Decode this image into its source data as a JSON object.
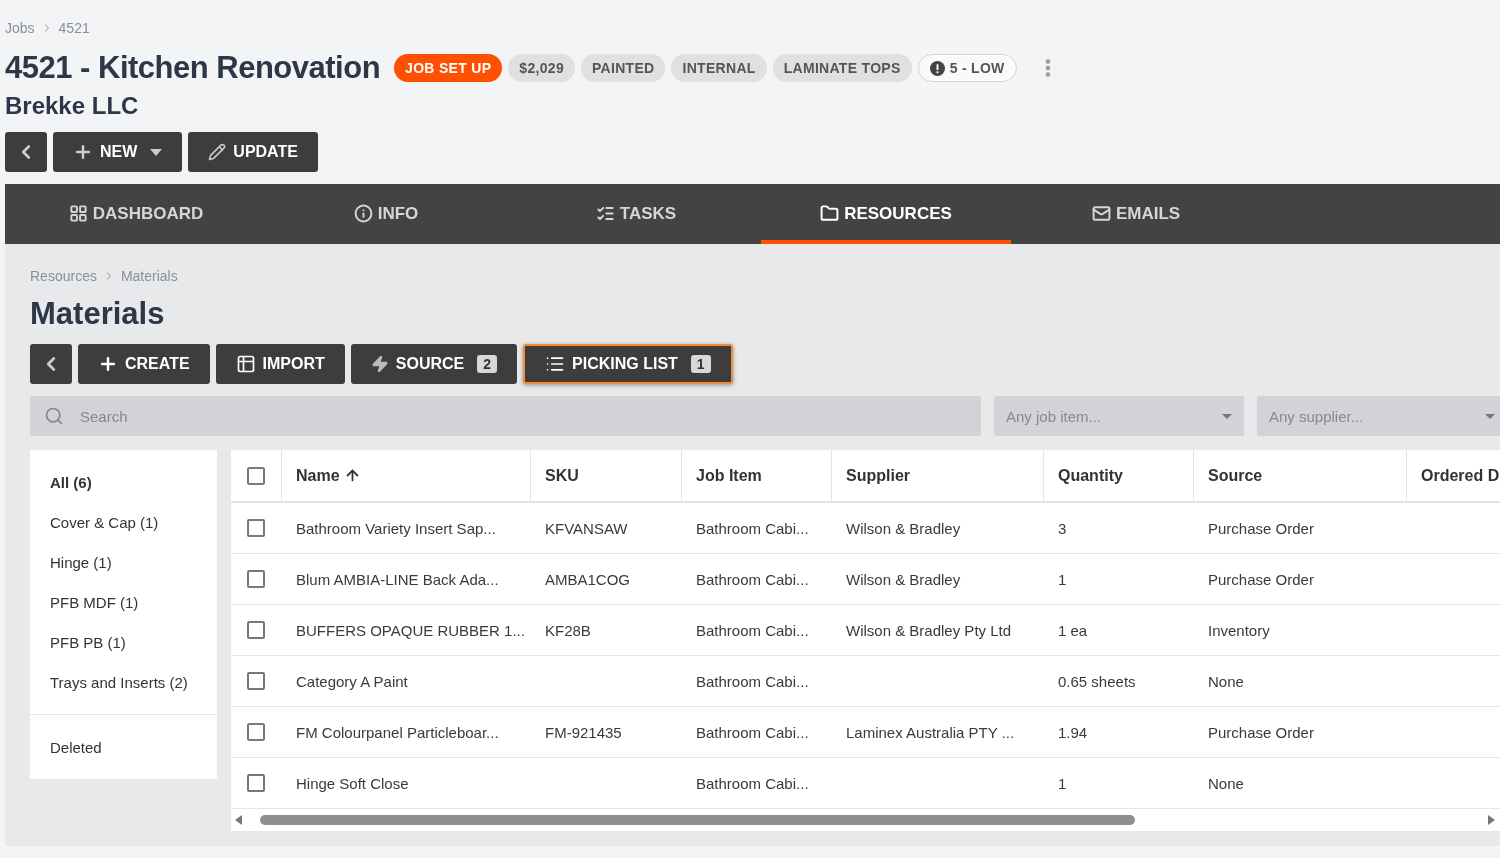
{
  "breadcrumb": [
    "Jobs",
    "4521"
  ],
  "title": "4521 - Kitchen Renovation",
  "tags": [
    {
      "kind": "status",
      "label": "JOB SET UP"
    },
    {
      "kind": "tag",
      "label": "$2,029"
    },
    {
      "kind": "tag",
      "label": "PAINTED"
    },
    {
      "kind": "tag",
      "label": "INTERNAL"
    },
    {
      "kind": "tag",
      "label": "LAMINATE TOPS"
    },
    {
      "kind": "priority",
      "label": "5 - LOW"
    }
  ],
  "customer": "Brekke LLC",
  "actions": [
    {
      "kind": "back"
    },
    {
      "kind": "new",
      "label": "NEW"
    },
    {
      "kind": "update",
      "label": "UPDATE"
    }
  ],
  "tabs": [
    {
      "label": "DASHBOARD",
      "selected": false
    },
    {
      "label": "INFO",
      "selected": false
    },
    {
      "label": "TASKS",
      "selected": false
    },
    {
      "label": "RESOURCES",
      "selected": true
    },
    {
      "label": "EMAILS",
      "selected": false
    }
  ],
  "section_breadcrumb": [
    "Resources",
    "Materials"
  ],
  "section_title": "Materials",
  "toolbar": [
    {
      "kind": "back"
    },
    {
      "kind": "create",
      "label": "CREATE",
      "selected": false
    },
    {
      "kind": "import",
      "label": "IMPORT",
      "selected": false
    },
    {
      "kind": "source",
      "label": "SOURCE",
      "count": "2",
      "selected": false
    },
    {
      "kind": "picking",
      "label": "PICKING LIST",
      "count": "1",
      "selected": true
    }
  ],
  "search": {
    "placeholder": "Search"
  },
  "filters": [
    {
      "placeholder": "Any job item..."
    },
    {
      "placeholder": "Any supplier..."
    }
  ],
  "categories": [
    {
      "label": "All (6)",
      "selected": true
    },
    {
      "label": "Cover & Cap (1)",
      "selected": false
    },
    {
      "label": "Hinge (1)",
      "selected": false
    },
    {
      "label": "PFB MDF (1)",
      "selected": false
    },
    {
      "label": "PFB PB (1)",
      "selected": false
    },
    {
      "label": "Trays and Inserts (2)",
      "selected": false
    }
  ],
  "deleted_label": "Deleted",
  "table": {
    "header_checked": false,
    "columns": [
      {
        "label": "Name",
        "sorted": true
      },
      {
        "label": "SKU",
        "sorted": false
      },
      {
        "label": "Job Item",
        "sorted": false
      },
      {
        "label": "Supplier",
        "sorted": false
      },
      {
        "label": "Quantity",
        "sorted": false
      },
      {
        "label": "Source",
        "sorted": false
      },
      {
        "label": "Ordered D",
        "sorted": false
      }
    ],
    "rows": [
      {
        "checked": false,
        "cells": [
          "Bathroom Variety Insert Sap...",
          "KFVANSAW",
          "Bathroom Cabi...",
          "Wilson & Bradley",
          "3",
          "Purchase Order"
        ]
      },
      {
        "checked": false,
        "cells": [
          "Blum AMBIA-LINE Back Ada...",
          "AMBA1COG",
          "Bathroom Cabi...",
          "Wilson & Bradley",
          "1",
          "Purchase Order"
        ]
      },
      {
        "checked": false,
        "cells": [
          "BUFFERS OPAQUE RUBBER 1...",
          "KF28B",
          "Bathroom Cabi...",
          "Wilson & Bradley Pty Ltd",
          "1 ea",
          "Inventory"
        ]
      },
      {
        "checked": false,
        "cells": [
          "Category A Paint",
          "",
          "Bathroom Cabi...",
          "",
          "0.65 sheets",
          "None"
        ]
      },
      {
        "checked": false,
        "cells": [
          "FM Colourpanel Particleboar...",
          "FM-921435",
          "Bathroom Cabi...",
          "Laminex Australia PTY ...",
          "1.94",
          "Purchase Order"
        ]
      },
      {
        "checked": false,
        "cells": [
          "Hinge Soft Close",
          "",
          "Bathroom Cabi...",
          "",
          "1",
          "None"
        ]
      }
    ]
  }
}
